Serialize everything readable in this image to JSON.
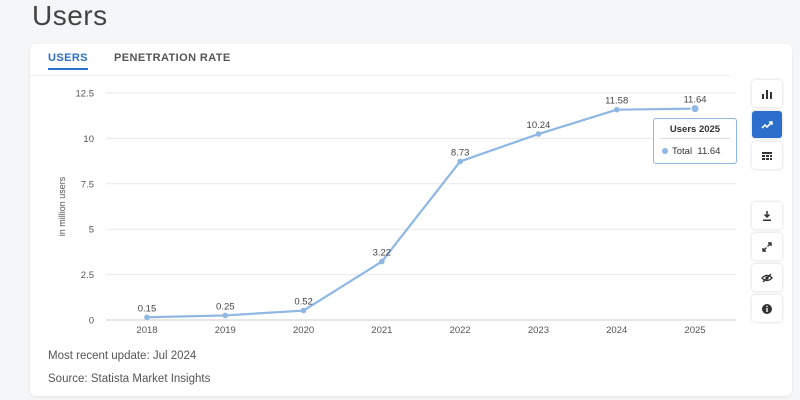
{
  "page": {
    "title": "Users"
  },
  "tabs": [
    {
      "label": "USERS",
      "active": true
    },
    {
      "label": "PENETRATION RATE",
      "active": false
    }
  ],
  "chart_data": {
    "type": "line",
    "categories": [
      "2018",
      "2019",
      "2020",
      "2021",
      "2022",
      "2023",
      "2024",
      "2025"
    ],
    "series": [
      {
        "name": "Total",
        "values": [
          0.15,
          0.25,
          0.52,
          3.22,
          8.73,
          10.24,
          11.58,
          11.64
        ],
        "color": "#8fb7e3"
      }
    ],
    "data_labels": [
      "0.15",
      "0.25",
      "0.52",
      "3.22",
      "8.73",
      "10.24",
      "11.58",
      "11.64"
    ],
    "ylabel": "in million users",
    "ylim": [
      0,
      12.5
    ],
    "yticks": [
      0,
      2.5,
      5,
      7.5,
      10,
      12.5
    ],
    "ytick_labels": [
      "0",
      "2.5",
      "5",
      "7.5",
      "10",
      "12.5"
    ],
    "grid": true
  },
  "tooltip": {
    "title": "Users 2025",
    "series_name": "Total",
    "value": "11.64"
  },
  "footer": {
    "update": "Most recent update: Jul 2024",
    "source": "Source: Statista Market Insights"
  },
  "toolbar": {
    "items": [
      {
        "name": "bar-chart-icon",
        "active": false
      },
      {
        "name": "line-chart-icon",
        "active": true
      },
      {
        "name": "table-icon",
        "active": false
      },
      {
        "name": "download-icon",
        "active": false
      },
      {
        "name": "expand-icon",
        "active": false
      },
      {
        "name": "hide-icon",
        "active": false
      },
      {
        "name": "info-icon",
        "active": false
      }
    ]
  },
  "colors": {
    "accent": "#2c6ecb",
    "line": "#8fb7e3"
  }
}
